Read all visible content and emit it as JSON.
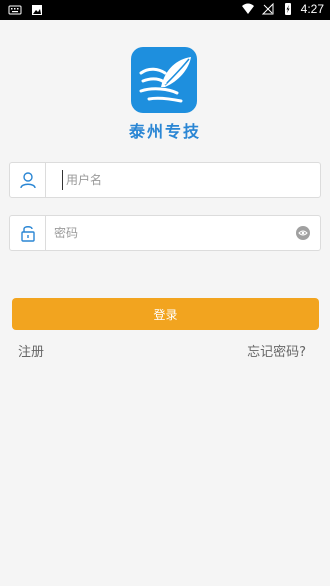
{
  "status_bar": {
    "time": "4:27",
    "icons": [
      "keyboard-icon",
      "image-icon",
      "wifi-icon",
      "signal-icon",
      "battery-icon"
    ]
  },
  "app": {
    "name": "泰州专技",
    "logo_icon": "quill-logo-icon",
    "accent_color": "#1e8fde"
  },
  "form": {
    "username": {
      "icon": "user-icon",
      "placeholder": "用户名",
      "value": ""
    },
    "password": {
      "icon": "lock-icon",
      "placeholder": "密码",
      "value": "",
      "toggle_icon": "eye-icon"
    },
    "login_label": "登录",
    "login_color": "#f2a41f"
  },
  "links": {
    "register": "注册",
    "forgot_password": "忘记密码?"
  }
}
